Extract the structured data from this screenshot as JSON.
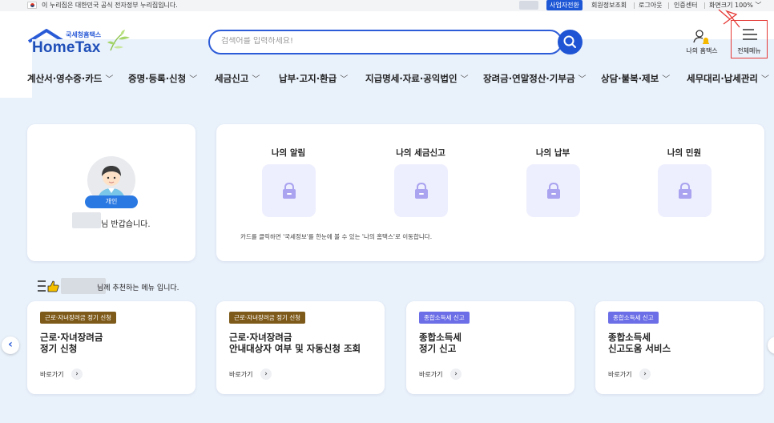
{
  "topbar": {
    "notice": "이 누리집은 대한민국 공식 전자정부 누리집입니다.",
    "business_switch": "사업자전환",
    "member_info": "회원정보조회",
    "logout": "로그아웃",
    "cert_center": "인증센터",
    "screen_size": "화면크기 100%",
    "screen_size_chevron": "﹀"
  },
  "header": {
    "logo_sub": "국세청홈택스",
    "logo_main": "HomeTax",
    "search_placeholder": "검색어를 입력하세요!",
    "my_hometax": "나의 홈택스",
    "all_menu": "전체메뉴"
  },
  "nav": {
    "items": [
      {
        "label": "계산서·영수증·카드"
      },
      {
        "label": "증명·등록·신청"
      },
      {
        "label": "세금신고"
      },
      {
        "label": "납부·고지·환급"
      },
      {
        "label": "지급명세·자료·공익법인"
      },
      {
        "label": "장려금·연말정산·기부금"
      },
      {
        "label": "상담·불복·제보"
      },
      {
        "label": "세무대리·납세관리"
      }
    ],
    "chevron": "﹀"
  },
  "profile": {
    "badge": "개인",
    "greeting": "님 반갑습니다."
  },
  "mine": {
    "cols": [
      {
        "title": "나의 알림"
      },
      {
        "title": "나의 세금신고"
      },
      {
        "title": "나의 납부"
      },
      {
        "title": "나의 민원"
      }
    ],
    "hint": "카드를 클릭하면 '국세정보'를 한눈에 볼 수 있는 '나의 홈택스'로 이동합니다."
  },
  "recommend": {
    "title_suffix": "님께 추천하는 메뉴 입니다.",
    "go_label": "바로가기",
    "go_arrow": "›",
    "cards": [
      {
        "tag": "근로·자녀장려금 정기 신청",
        "line1": "근로·자녀장려금",
        "line2": "정기 신청"
      },
      {
        "tag": "근로·자녀장려금 정기 신청",
        "line1": "근로·자녀장려금",
        "line2": "안내대상자 여부 및 자동신청 조회"
      },
      {
        "tag": "종합소득세 신고",
        "line1": "종합소득세",
        "line2": "정기 신고"
      },
      {
        "tag": "종합소득세 신고",
        "line1": "종합소득세",
        "line2": "신고도움 서비스"
      }
    ]
  },
  "carousel": {
    "prev": "‹"
  },
  "colors": {
    "primary": "#1f55d4",
    "tag_brown": "#7e5a1a",
    "tag_purple": "#6b6ee6",
    "bg": "#e9f1fb"
  }
}
